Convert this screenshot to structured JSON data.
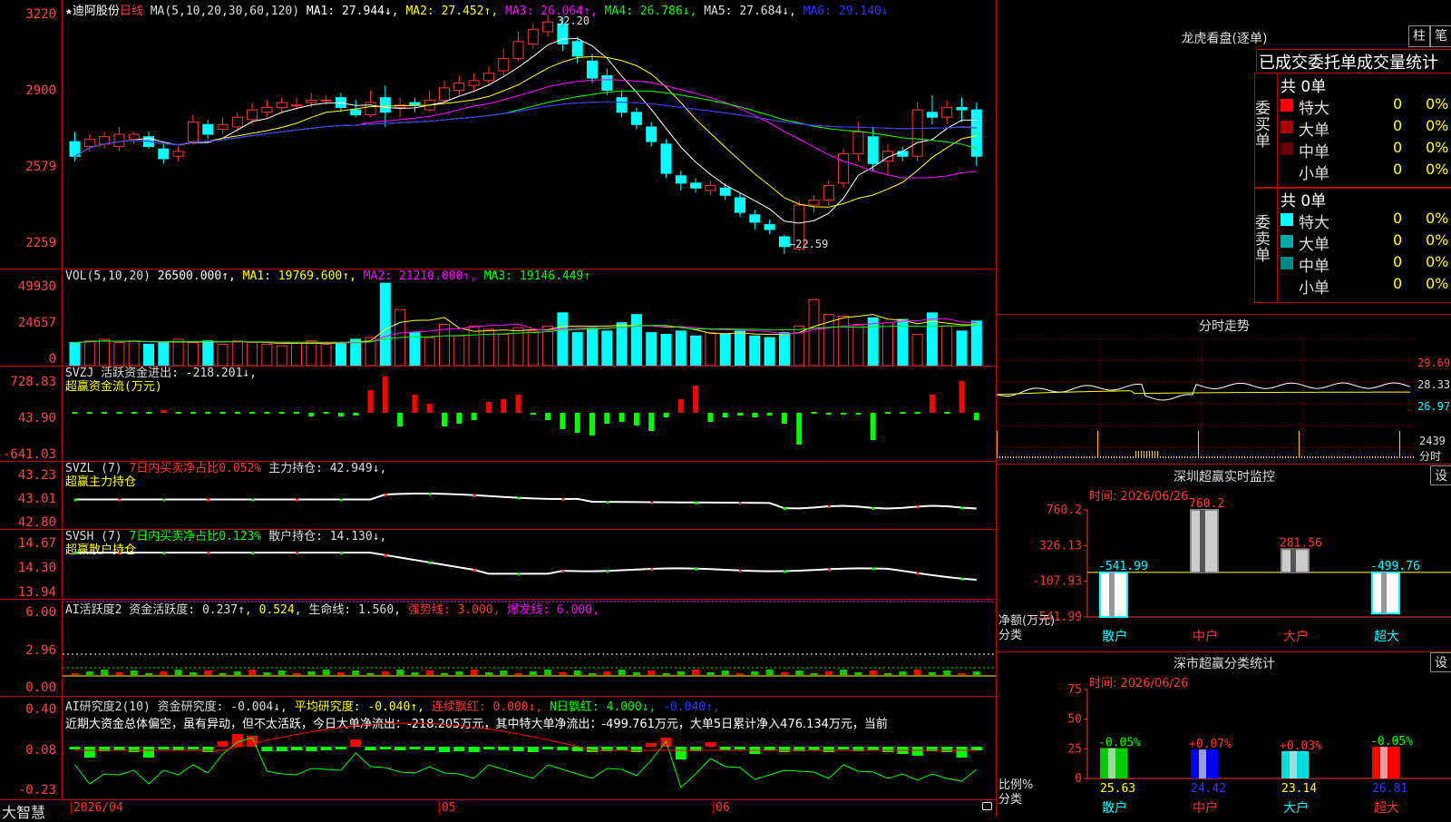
{
  "stock": {
    "name": "迪阿股份",
    "star": "★",
    "period": "日线"
  },
  "ma_header": [
    {
      "text": "MA(5,10,20,30,60,120)",
      "color": "#dddddd"
    },
    {
      "text": "MA1: 27.944↓,",
      "color": "#ffffff"
    },
    {
      "text": "MA2: 27.452↑,",
      "color": "#ffff00"
    },
    {
      "text": "MA3: 26.064↑,",
      "color": "#ff00ff"
    },
    {
      "text": "MA4: 26.786↓,",
      "color": "#00ff00"
    },
    {
      "text": "MA5: 27.684↓,",
      "color": "#dddddd"
    },
    {
      "text": "MA6: 29.140↓",
      "color": "#3333ff"
    }
  ],
  "price_axis": [
    "3220",
    "2900",
    "2579",
    "2259"
  ],
  "price_marks": {
    "high": "32.20",
    "low": "←22.59"
  },
  "vol_header": [
    {
      "text": "VOL(5,10,20)",
      "color": "#dddddd"
    },
    {
      "text": "26500.000↑,",
      "color": "#ffffff"
    },
    {
      "text": "MA1: 19769.600↑,",
      "color": "#ffff00"
    },
    {
      "text": "MA2: 21210.000↑,",
      "color": "#ff00ff"
    },
    {
      "text": "MA3: 19146.449↑",
      "color": "#00ff00"
    }
  ],
  "vol_axis": [
    "49930",
    "24657",
    "0"
  ],
  "svzj": {
    "header1": "SVZJ  活跃资金进出: -218.201↓,",
    "header2": "超赢资金流(万元)",
    "axis": [
      "728.83",
      "43.90",
      "-641.03"
    ]
  },
  "svzl": {
    "header1": "SVZL (7)",
    "header2": "7日内买卖净占比0.052%",
    "header3": "主力持仓: 42.949↓,",
    "header4": "超赢主力持仓",
    "axis": [
      "43.23",
      "43.01",
      "42.80"
    ]
  },
  "svsh": {
    "header1": "SVSH (7)",
    "header2": "7日内买卖净占比0.123%",
    "header3": "散户持仓: 14.130↓,",
    "header4": "超赢散户持仓",
    "axis": [
      "14.67",
      "14.30",
      "13.94"
    ]
  },
  "ai2": {
    "parts": [
      {
        "text": "AI活跃度2 资金活跃度: 0.237↑,",
        "color": "#dddddd"
      },
      {
        "text": "0.524,",
        "color": "#ffff00"
      },
      {
        "text": "生命线: 1.560,",
        "color": "#dddddd"
      },
      {
        "text": "强势线: 3.000,",
        "color": "#ff3333"
      },
      {
        "text": "爆发线: 6.000,",
        "color": "#ff00ff"
      }
    ],
    "axis": [
      "6.00",
      "2.96",
      "0.00"
    ]
  },
  "ai_research": {
    "parts": [
      {
        "text": "AI研究度2(10) 资金研究度: -0.004↓,",
        "color": "#dddddd"
      },
      {
        "text": "平均研究度: -0.040↑,",
        "color": "#ffff00"
      },
      {
        "text": "连续飘红: 0.000↓,",
        "color": "#ff3333"
      },
      {
        "text": "N日飘红: 4.000↓,",
        "color": "#00ff00"
      },
      {
        "text": "-0.040↑,",
        "color": "#3333ff"
      }
    ],
    "desc": "近期大资金总体偏空，虽有异动，但不太活跃，今日大单净流出：-218.205万元，其中特大单净流出：-499.761万元，大单5日累计净入476.134万元，当前",
    "axis": [
      "0.40",
      "0.08",
      "-0.23"
    ]
  },
  "date_axis": {
    "start": "2026/04",
    "m1": "05",
    "m2": "06",
    "brand": "大智慧"
  },
  "dragon": {
    "title": "龙虎看盘(逐单)",
    "btn1": "柱",
    "btn2": "笔",
    "tabs": "已成交委托单成交量统计",
    "buy_label": "委买单",
    "sell_label": "委卖单",
    "buy_total": "共 0单",
    "sell_total": "共 0单",
    "buy_rows": [
      {
        "label": "特大",
        "count": "0",
        "pct": "0%",
        "color": "#ff0000"
      },
      {
        "label": "大单",
        "count": "0",
        "pct": "0%",
        "color": "#aa0000"
      },
      {
        "label": "中单",
        "count": "0",
        "pct": "0%",
        "color": "#660000"
      },
      {
        "label": "小单",
        "count": "0",
        "pct": "0%",
        "color": "#000000"
      }
    ],
    "sell_rows": [
      {
        "label": "特大",
        "count": "0",
        "pct": "0%",
        "color": "#00ffff"
      },
      {
        "label": "大单",
        "count": "0",
        "pct": "0%",
        "color": "#00aaaa"
      },
      {
        "label": "中单",
        "count": "0",
        "pct": "0%",
        "color": "#008888"
      },
      {
        "label": "小单",
        "count": "0",
        "pct": "0%",
        "color": "#000000"
      }
    ]
  },
  "intraday": {
    "title": "分时走势",
    "axis": [
      "29.69",
      "28.33",
      "26.97"
    ],
    "vol": "2439",
    "vol_unit": "分时"
  },
  "monitor": {
    "title": "深圳超赢实时监控",
    "btn": "设",
    "time": "时间: 2026/06/26",
    "axis": [
      "760.2",
      "326.13",
      "-107.93",
      "-541.99"
    ],
    "ylabel": "净额(万元)",
    "xlabel": "分类",
    "bars": [
      {
        "cat": "散户",
        "value": -541.99,
        "label": "-541.99",
        "cat_color": "#00ffff"
      },
      {
        "cat": "中户",
        "value": 760.2,
        "label": "760.2",
        "cat_color": "#ff3333"
      },
      {
        "cat": "大户",
        "value": 281.56,
        "label": "281.56",
        "cat_color": "#ff3333"
      },
      {
        "cat": "超大",
        "value": -499.76,
        "label": "-499.76",
        "cat_color": "#00ffff"
      }
    ]
  },
  "classify": {
    "title": "深市超赢分类统计",
    "btn": "设",
    "time": "时间: 2026/06/26",
    "axis": [
      "75",
      "50",
      "25",
      "0"
    ],
    "ylabel": "比例%",
    "xlabel": "分类",
    "bars": [
      {
        "cat": "散户",
        "value": 25.63,
        "label": "25.63",
        "pct": "-0.05%",
        "pct_color": "#00ff00",
        "color": "#00cc00",
        "cat_color": "#00ffff"
      },
      {
        "cat": "中户",
        "value": 24.42,
        "label": "24.42",
        "pct": "+0.07%",
        "pct_color": "#ff3333",
        "color": "#0000ff",
        "cat_color": "#ff3333"
      },
      {
        "cat": "大户",
        "value": 23.14,
        "label": "23.14",
        "pct": "+0.03%",
        "pct_color": "#ff3333",
        "color": "#00dddd",
        "cat_color": "#00ffff"
      },
      {
        "cat": "超大",
        "value": 26.81,
        "label": "26.81",
        "pct": "-0.05%",
        "pct_color": "#00ff00",
        "color": "#ff0000",
        "cat_color": "#ff3333"
      }
    ]
  },
  "chart_data": {
    "type": "candlestick",
    "ylim": [
      22.0,
      33.0
    ],
    "candles": [
      [
        27.2,
        26.6,
        27.6,
        26.4
      ],
      [
        27.0,
        27.3,
        27.5,
        26.8
      ],
      [
        27.1,
        27.4,
        27.6,
        26.9
      ],
      [
        27.0,
        27.5,
        27.8,
        26.8
      ],
      [
        27.3,
        27.5,
        27.6,
        27.1
      ],
      [
        27.4,
        27.0,
        27.6,
        26.9
      ],
      [
        26.9,
        26.5,
        27.1,
        26.3
      ],
      [
        26.6,
        26.8,
        27.0,
        26.4
      ],
      [
        27.2,
        28.0,
        28.3,
        27.1
      ],
      [
        27.9,
        27.5,
        28.1,
        27.3
      ],
      [
        27.7,
        27.9,
        28.2,
        27.5
      ],
      [
        27.8,
        28.2,
        28.4,
        27.6
      ],
      [
        28.1,
        28.5,
        28.8,
        27.9
      ],
      [
        28.4,
        28.6,
        28.9,
        28.2
      ],
      [
        28.6,
        28.8,
        29.0,
        28.4
      ],
      [
        28.7,
        28.7,
        29.0,
        28.5
      ],
      [
        28.8,
        28.9,
        29.2,
        28.6
      ],
      [
        28.9,
        28.9,
        29.1,
        28.7
      ],
      [
        29.0,
        28.6,
        29.2,
        28.4
      ],
      [
        28.5,
        28.3,
        28.9,
        28.2
      ],
      [
        28.3,
        28.8,
        29.3,
        28.2
      ],
      [
        29.0,
        28.4,
        29.5,
        27.8
      ],
      [
        28.6,
        28.7,
        29.0,
        28.2
      ],
      [
        28.8,
        28.7,
        29.0,
        28.4
      ],
      [
        28.5,
        28.9,
        29.3,
        28.4
      ],
      [
        28.9,
        29.4,
        29.7,
        28.8
      ],
      [
        29.3,
        29.6,
        29.9,
        29.1
      ],
      [
        29.5,
        29.7,
        30.0,
        29.3
      ],
      [
        29.7,
        30.0,
        30.3,
        29.5
      ],
      [
        30.1,
        30.6,
        31.0,
        29.9
      ],
      [
        30.6,
        31.3,
        31.7,
        30.5
      ],
      [
        31.2,
        31.8,
        32.0,
        31.0
      ],
      [
        31.7,
        32.1,
        32.4,
        31.5
      ],
      [
        32.0,
        31.2,
        32.3,
        30.9
      ],
      [
        31.3,
        30.7,
        31.5,
        30.4
      ],
      [
        30.5,
        29.8,
        30.8,
        29.6
      ],
      [
        29.9,
        29.3,
        30.2,
        29.1
      ],
      [
        29.0,
        28.4,
        29.3,
        28.2
      ],
      [
        28.4,
        27.9,
        28.6,
        27.7
      ],
      [
        27.8,
        27.2,
        28.0,
        27.0
      ],
      [
        27.1,
        25.9,
        27.3,
        25.7
      ],
      [
        25.8,
        25.5,
        26.0,
        25.2
      ],
      [
        25.5,
        25.3,
        25.7,
        25.1
      ],
      [
        25.2,
        25.4,
        25.6,
        25.0
      ],
      [
        25.3,
        25.0,
        25.5,
        24.8
      ],
      [
        24.9,
        24.3,
        25.1,
        24.1
      ],
      [
        24.2,
        23.9,
        24.4,
        23.6
      ],
      [
        23.8,
        23.6,
        24.0,
        23.4
      ],
      [
        23.3,
        22.9,
        23.4,
        22.59
      ],
      [
        22.8,
        24.6,
        24.8,
        22.7
      ],
      [
        24.6,
        24.8,
        25.0,
        24.3
      ],
      [
        24.8,
        25.4,
        25.6,
        24.6
      ],
      [
        25.5,
        26.7,
        26.9,
        25.3
      ],
      [
        26.7,
        27.6,
        28.0,
        26.4
      ],
      [
        27.4,
        26.3,
        27.8,
        26.0
      ],
      [
        26.4,
        26.8,
        27.1,
        25.8
      ],
      [
        26.8,
        26.6,
        27.0,
        26.4
      ],
      [
        26.6,
        28.5,
        28.8,
        26.4
      ],
      [
        28.4,
        28.2,
        29.1,
        27.9
      ],
      [
        28.2,
        28.6,
        28.9,
        27.9
      ],
      [
        28.6,
        28.5,
        29.0,
        28.0
      ],
      [
        28.5,
        26.6,
        28.8,
        26.2
      ]
    ]
  }
}
